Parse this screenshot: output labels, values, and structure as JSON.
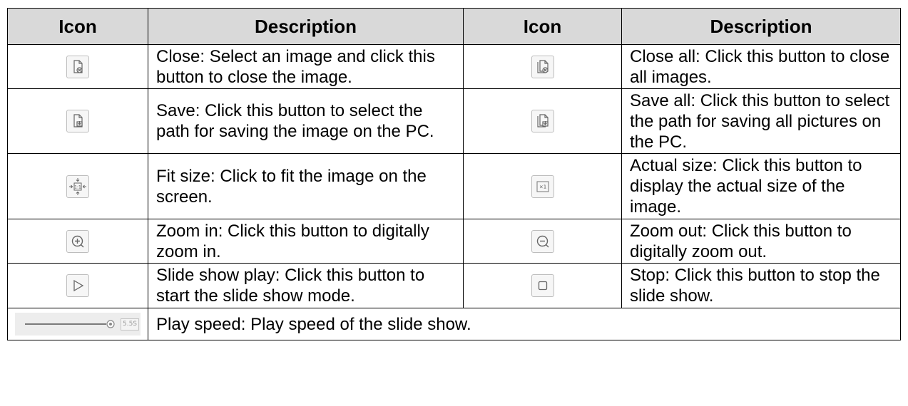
{
  "headers": {
    "icon1": "Icon",
    "desc1": "Description",
    "icon2": "Icon",
    "desc2": "Description"
  },
  "rows": [
    {
      "left_icon": "close-icon",
      "left_desc": "Close: Select an image and click this button to close the image.",
      "right_icon": "close-all-icon",
      "right_desc": "Close all: Click this button to close all images."
    },
    {
      "left_icon": "save-icon",
      "left_desc": "Save: Click this button to select the path for saving the image on the PC.",
      "right_icon": "save-all-icon",
      "right_desc": "Save all: Click this button to select the path for saving all pictures on the PC."
    },
    {
      "left_icon": "fit-size-icon",
      "left_desc": "Fit size: Click to fit the image on the screen.",
      "right_icon": "actual-size-icon",
      "right_desc": "Actual size: Click this button to display the actual size of the image."
    },
    {
      "left_icon": "zoom-in-icon",
      "left_desc": "Zoom in: Click this button to digitally zoom in.",
      "right_icon": "zoom-out-icon",
      "right_desc": "Zoom out: Click this button to digitally zoom out."
    },
    {
      "left_icon": "play-icon",
      "left_desc": "Slide show play: Click this button to start the slide show mode.",
      "right_icon": "stop-icon",
      "right_desc": "Stop: Click this button to stop the slide show."
    }
  ],
  "speed_row": {
    "icon": "play-speed-slider-icon",
    "slider_value": "5.5S",
    "desc": "Play speed: Play speed of the slide show."
  }
}
